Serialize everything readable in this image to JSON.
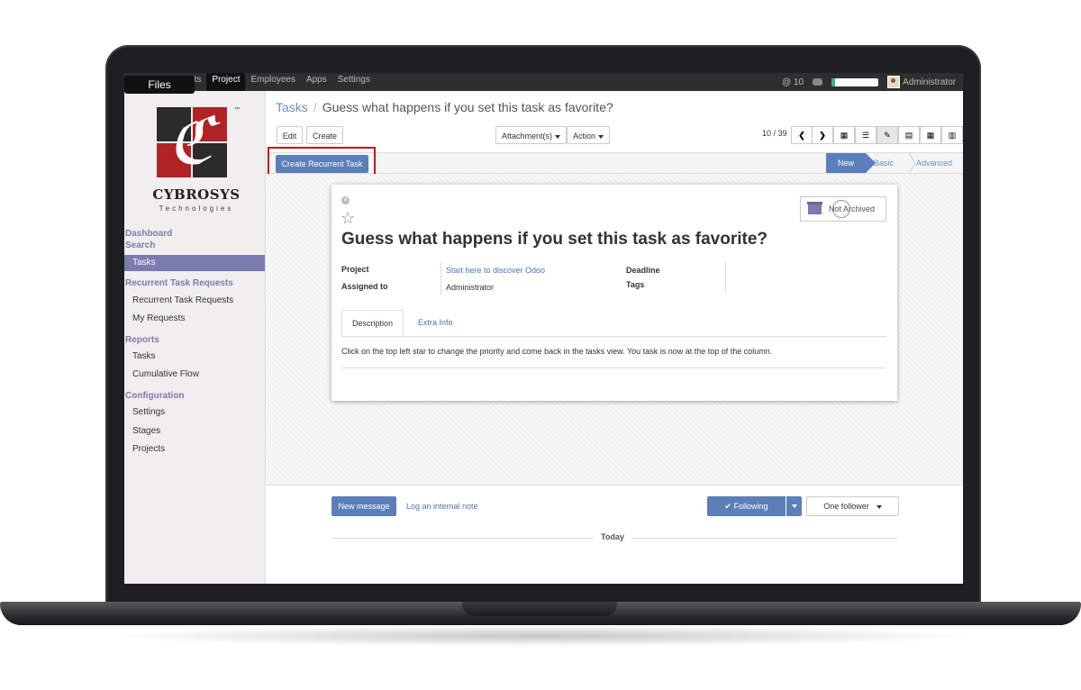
{
  "tooltip": {
    "files": "Files"
  },
  "topnav": {
    "items": [
      {
        "label": "acts"
      },
      {
        "label": "Project"
      },
      {
        "label": "Employees"
      },
      {
        "label": "Apps"
      },
      {
        "label": "Settings"
      }
    ],
    "active": "Project",
    "mentions": "@ 10",
    "user": "Administrator",
    "progress": 0.08
  },
  "logo": {
    "name": "CYBROSYS",
    "sub": "Technologies",
    "tm": "™"
  },
  "sidebar": {
    "dashboard": "Dashboard",
    "search": "Search",
    "tasks": "Tasks",
    "recurrent_header": "Recurrent Task Requests",
    "recurrent_items": [
      "Recurrent Task Requests",
      "My Requests"
    ],
    "reports_header": "Reports",
    "reports_items": [
      "Tasks",
      "Cumulative Flow"
    ],
    "config_header": "Configuration",
    "config_items": [
      "Settings",
      "Stages",
      "Projects"
    ]
  },
  "breadcrumb": {
    "parent": "Tasks",
    "current": "Guess what happens if you set this task as favorite?"
  },
  "toolbar": {
    "edit": "Edit",
    "create": "Create",
    "attachments": "Attachment(s)",
    "action": "Action",
    "pager": "10 / 39"
  },
  "statusbar": {
    "create_recurrent": "Create Recurrent Task",
    "stages": {
      "new": "New",
      "basic": "Basic",
      "advanced": "Advanced"
    }
  },
  "form": {
    "archived": "Not Archived",
    "title": "Guess what happens if you set this task as favorite?",
    "project_label": "Project",
    "project_value": "Start here to discover Odoo",
    "assigned_label": "Assigned to",
    "assigned_value": "Administrator",
    "deadline_label": "Deadline",
    "tags_label": "Tags",
    "tab_description": "Description",
    "tab_extra": "Extra Info",
    "description": "Click on the top left star to change the priority and come back in the tasks view. You task is now at the top of the column."
  },
  "chatter": {
    "new_message": "New message",
    "log_note": "Log an internal note",
    "following": "✔ Following",
    "followers": "One follower",
    "today": "Today"
  },
  "colors": {
    "accent": "#5b7fb8",
    "sidebar_active": "#7c7bad",
    "highlight": "#c0181c",
    "logo_red": "#b22326",
    "logo_dark": "#2b2b2b"
  }
}
